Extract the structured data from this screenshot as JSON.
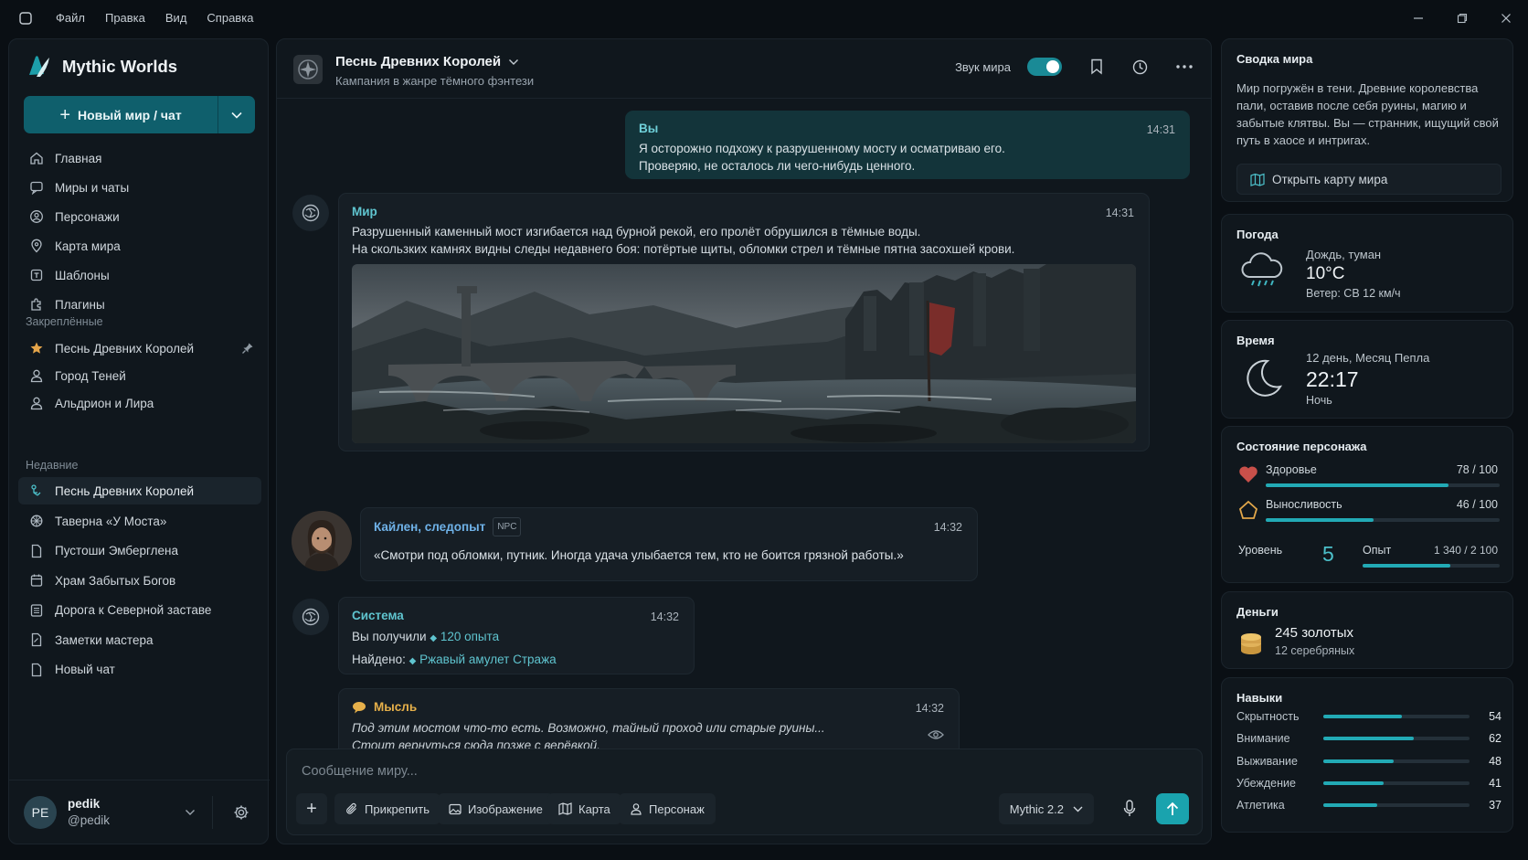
{
  "menu": {
    "file": "Файл",
    "edit": "Правка",
    "view": "Вид",
    "help": "Справка"
  },
  "sidebar": {
    "brand": "Mythic Worlds",
    "new_button": "Новый мир / чат",
    "nav": [
      {
        "label": "Главная",
        "icon": "home-icon"
      },
      {
        "label": "Миры и чаты",
        "icon": "chat-icon"
      },
      {
        "label": "Персонажи",
        "icon": "character-icon"
      },
      {
        "label": "Карта мира",
        "icon": "map-icon"
      },
      {
        "label": "Шаблоны",
        "icon": "template-icon"
      },
      {
        "label": "Плагины",
        "icon": "plugin-icon"
      }
    ],
    "pinned_title": "Закреплённые",
    "pinned": [
      {
        "label": "Песнь Древних Королей",
        "icon": "star-icon"
      },
      {
        "label": "Город Теней",
        "icon": "user-icon"
      },
      {
        "label": "Альдрион и Лира",
        "icon": "user-icon"
      }
    ],
    "recent_title": "Недавние",
    "recent": [
      {
        "label": "Песнь Древних Королей",
        "icon": "world-icon"
      },
      {
        "label": "Таверна «У Моста»",
        "icon": "tavern-icon"
      },
      {
        "label": "Пустоши Эмберглена",
        "icon": "doc-icon"
      },
      {
        "label": "Храм Забытых Богов",
        "icon": "calendar-icon"
      },
      {
        "label": "Дорога к Северной заставе",
        "icon": "list-icon"
      },
      {
        "label": "Заметки мастера",
        "icon": "note-icon"
      },
      {
        "label": "Новый чат",
        "icon": "doc-icon"
      }
    ],
    "user": {
      "initials": "PE",
      "name": "pedik",
      "handle": "@pedik"
    }
  },
  "chat": {
    "title": "Песнь Древних Королей",
    "subtitle": "Кампания в жанре тёмного фэнтези",
    "sound_label": "Звук мира",
    "messages": {
      "user": {
        "who": "Вы",
        "time": "14:31",
        "line1": "Я осторожно подхожу к разрушенному мосту и осматриваю его.",
        "line2": "Проверяю, не осталось ли чего-нибудь ценного."
      },
      "world": {
        "who": "Мир",
        "time": "14:31",
        "line1": "Разрушенный каменный мост изгибается над бурной рекой, его пролёт обрушился в тёмные воды.",
        "line2": "На скользких камнях видны следы недавнего боя: потёртые щиты, обломки стрел и тёмные пятна засохшей крови."
      },
      "npc": {
        "who": "Кайлен, следопыт",
        "tag": "NPC",
        "time": "14:32",
        "text": "«Смотри под обломки, путник. Иногда удача улыбается тем, кто не боится грязной работы.»"
      },
      "system": {
        "who": "Система",
        "time": "14:32",
        "got": "Вы получили",
        "xp": "120 опыта",
        "found": "Найдено:",
        "item": "Ржавый амулет Стража"
      },
      "thought": {
        "who": "Мысль",
        "time": "14:32",
        "line1": "Под этим мостом что-то есть. Возможно, тайный проход или старые руины...",
        "line2": "Стоит вернуться сюда позже с верёвкой."
      }
    },
    "composer": {
      "placeholder": "Сообщение миру...",
      "attach": "Прикрепить",
      "image": "Изображение",
      "map": "Карта",
      "character": "Персонаж",
      "model": "Mythic 2.2"
    }
  },
  "right": {
    "summary": {
      "title": "Сводка мира",
      "text": "Мир погружён в тени. Древние королевства пали, оставив после себя руины, магию и забытые клятвы. Вы — странник, ищущий свой путь в хаосе и интригах.",
      "map_button": "Открыть карту мира"
    },
    "weather": {
      "title": "Погода",
      "desc": "Дождь, туман",
      "temp": "10°C",
      "wind": "Ветер: СВ 12 км/ч"
    },
    "time": {
      "title": "Время",
      "date": "12 день, Месяц Пепла",
      "clock": "22:17",
      "phase": "Ночь"
    },
    "status": {
      "title": "Состояние персонажа",
      "health_label": "Здоровье",
      "health": "78 / 100",
      "health_frac": 0.78,
      "stamina_label": "Выносливость",
      "stamina": "46 / 100",
      "stamina_frac": 0.46,
      "level_label": "Уровень",
      "level": "5",
      "xp_label": "Опыт",
      "xp": "1 340 / 2 100",
      "xp_frac": 0.64
    },
    "money": {
      "title": "Деньги",
      "gold": "245 золотых",
      "silver": "12 серебряных"
    },
    "skills": {
      "title": "Навыки",
      "items": [
        {
          "name": "Скрытность",
          "value": "54",
          "frac": 0.54
        },
        {
          "name": "Внимание",
          "value": "62",
          "frac": 0.62
        },
        {
          "name": "Выживание",
          "value": "48",
          "frac": 0.48
        },
        {
          "name": "Убеждение",
          "value": "41",
          "frac": 0.41
        },
        {
          "name": "Атлетика",
          "value": "37",
          "frac": 0.37
        }
      ]
    }
  },
  "colors": {
    "accent": "#1aa3ae",
    "bg": "#0a0f14",
    "panel": "#10171d",
    "user_bubble": "#13343a"
  }
}
